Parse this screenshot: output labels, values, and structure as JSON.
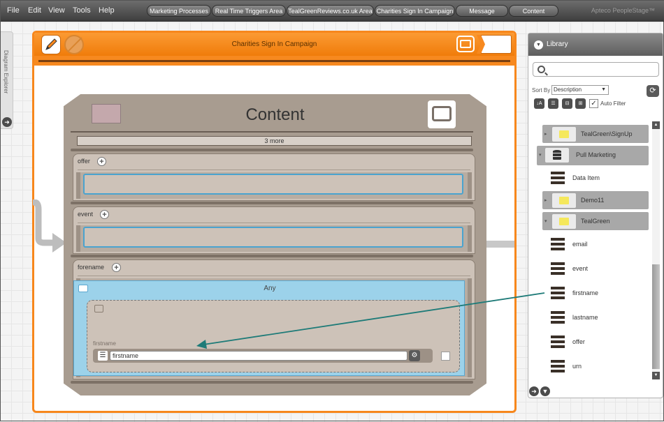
{
  "menu": {
    "file": "File",
    "edit": "Edit",
    "view": "View",
    "tools": "Tools",
    "help": "Help"
  },
  "breadcrumbs": [
    "Marketing Processes",
    "Real Time Triggers Area",
    "TealGreenReviews.co.uk Area",
    "Charities Sign In Campaign",
    "Message",
    "Content"
  ],
  "brand": "Apteco PeopleStage™",
  "diagram_explorer": {
    "label": "Diagram Explorer"
  },
  "campaign": {
    "title": "Charities Sign In Campaign"
  },
  "content_node": {
    "title": "Content",
    "more_label": "3 more",
    "sections": [
      {
        "label": "offer"
      },
      {
        "label": "event"
      },
      {
        "label": "forename"
      }
    ],
    "any_label": "Any",
    "firstname_label": "firstname",
    "firstname_value": "firstname"
  },
  "library": {
    "title": "Library",
    "search_placeholder": "",
    "sort_by_label": "Sort By",
    "sort_by_value": "Description",
    "auto_filter_label": "Auto Filter",
    "items": [
      {
        "label": "TealGreen\\SignUp",
        "kind": "folder"
      },
      {
        "label": "Pull Marketing",
        "kind": "database"
      },
      {
        "label": "Data Item",
        "kind": "item"
      },
      {
        "label": "Demo11",
        "kind": "folder"
      },
      {
        "label": "TealGreen",
        "kind": "folder"
      },
      {
        "label": "email",
        "kind": "item"
      },
      {
        "label": "event",
        "kind": "item"
      },
      {
        "label": "firstname",
        "kind": "item"
      },
      {
        "label": "lastname",
        "kind": "item"
      },
      {
        "label": "offer",
        "kind": "item"
      },
      {
        "label": "urn",
        "kind": "item"
      }
    ]
  },
  "colors": {
    "accent": "#f7871c",
    "drop_border": "#4aa3cf",
    "drag_arrow": "#1e7b78",
    "any_bg": "#9cd2ea"
  }
}
